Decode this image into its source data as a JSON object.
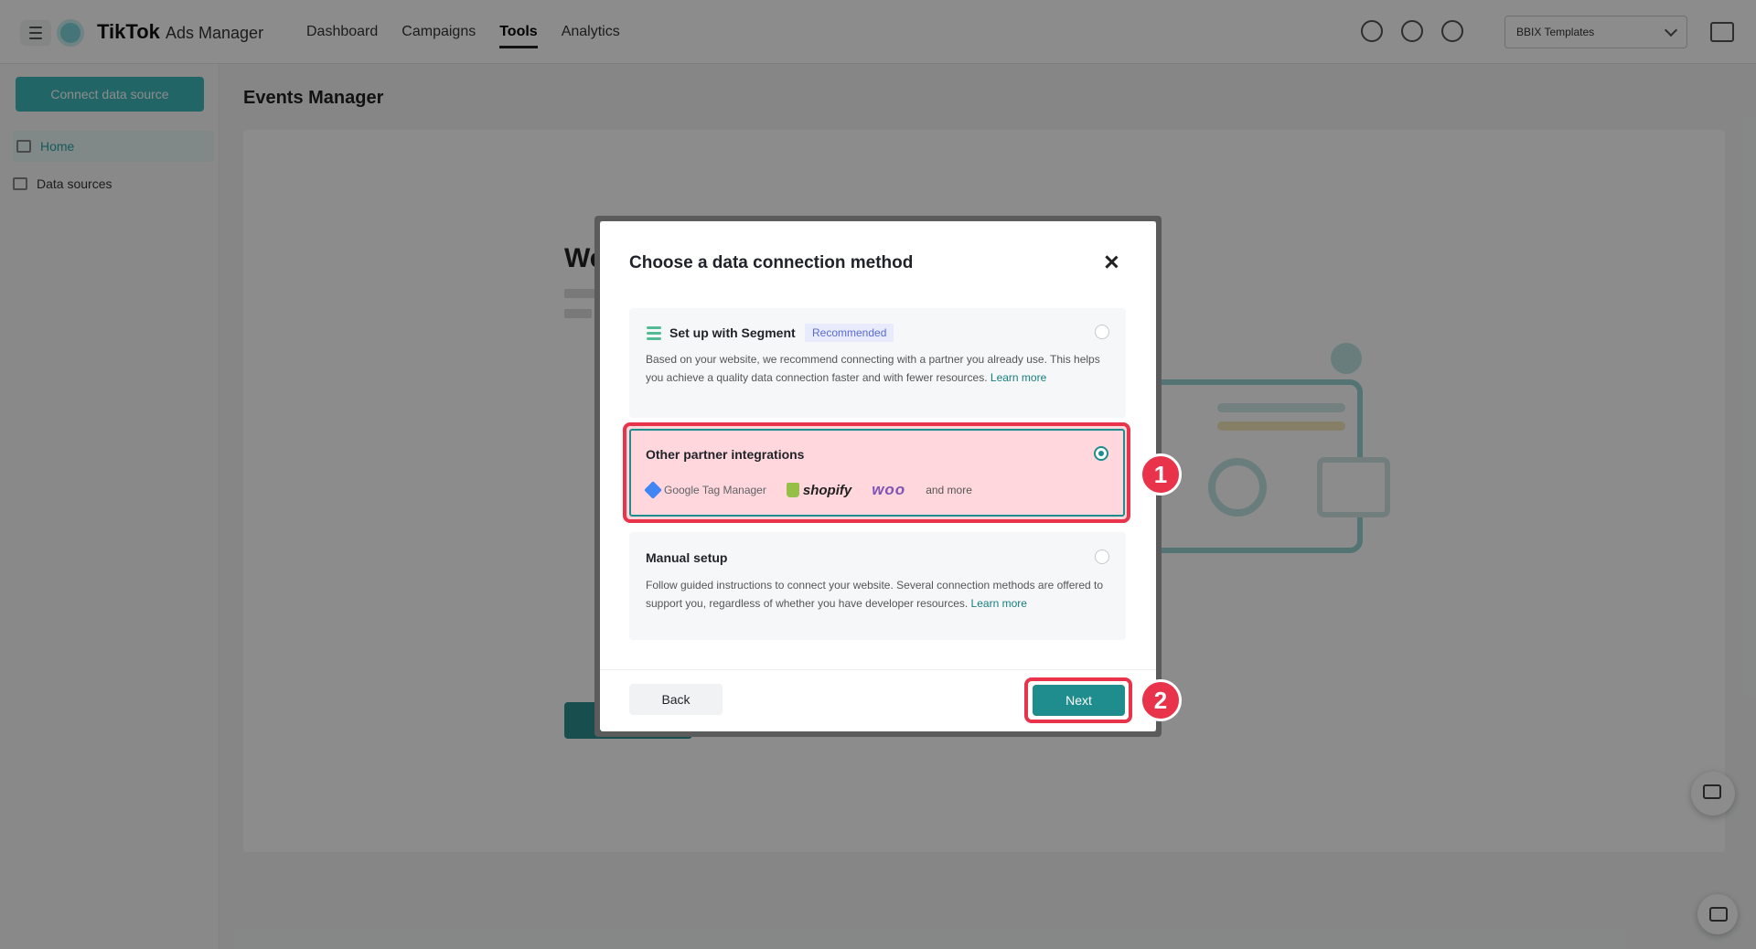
{
  "app": {
    "logo_main": "TikTok",
    "logo_sub": "Ads Manager",
    "nav": [
      "Dashboard",
      "Campaigns",
      "Tools",
      "Analytics"
    ],
    "account_select": "BBIX Templates"
  },
  "sidebar": {
    "connect_button": "Connect data source",
    "items": [
      "Home",
      "Data sources"
    ]
  },
  "page": {
    "title": "Events Manager",
    "bg_heading": "We"
  },
  "modal": {
    "title": "Choose a data connection method",
    "options": [
      {
        "title": "Set up with Segment",
        "badge": "Recommended",
        "desc": "Based on your website, we recommend connecting with a partner you already use. This helps you achieve a quality data connection faster and with fewer resources.",
        "link": "Learn more",
        "selected": false
      },
      {
        "title": "Other partner integrations",
        "partners": [
          "Google Tag Manager",
          "shopify",
          "woo"
        ],
        "more": "and more",
        "selected": true
      },
      {
        "title": "Manual setup",
        "desc": "Follow guided instructions to connect your website. Several connection methods are offered to support you, regardless of whether you have developer resources.",
        "link": "Learn more",
        "selected": false
      }
    ],
    "back_label": "Back",
    "next_label": "Next"
  },
  "annotations": {
    "step1": "1",
    "step2": "2"
  },
  "colors": {
    "accent": "#1f8d8e",
    "highlight": "#e8334a",
    "badge_text": "#5a6ad8"
  }
}
